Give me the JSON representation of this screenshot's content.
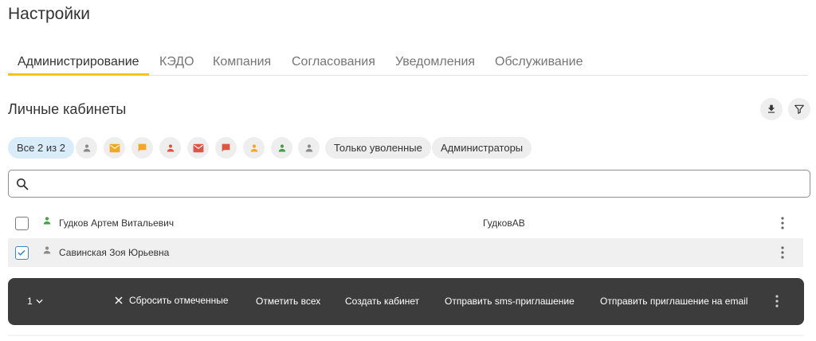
{
  "page": {
    "title": "Настройки"
  },
  "tabs": [
    "Администрирование",
    "КЭДО",
    "Компания",
    "Согласования",
    "Уведомления",
    "Обслуживание"
  ],
  "section": {
    "title": "Личные кабинеты"
  },
  "filters": {
    "all_label": "Все 2 из 2",
    "fired_label": "Только уволенные",
    "admins_label": "Администраторы",
    "icon_chips": [
      {
        "icon": "person-icon",
        "color": "#8a8a8a"
      },
      {
        "icon": "email-icon",
        "color": "#f5a623"
      },
      {
        "icon": "message-icon",
        "color": "#f5a623"
      },
      {
        "icon": "person-icon",
        "color": "#e05542"
      },
      {
        "icon": "email-icon",
        "color": "#e05542"
      },
      {
        "icon": "message-icon",
        "color": "#e05542"
      },
      {
        "icon": "person-icon",
        "color": "#f5a623"
      },
      {
        "icon": "person-icon",
        "color": "#43a047"
      },
      {
        "icon": "person-icon",
        "color": "#8a8a8a"
      }
    ]
  },
  "search": {
    "placeholder": "",
    "value": ""
  },
  "rows": [
    {
      "name": "Гудков Артем Витальевич",
      "login": "ГудковАВ",
      "checked": false,
      "status_color": "#43a047"
    },
    {
      "name": "Савинская Зоя Юрьевна",
      "login": "",
      "checked": true,
      "status_color": "#8a8a8a"
    }
  ],
  "action_bar": {
    "count": "1",
    "reset": "Сбросить отмеченные",
    "select_all": "Отметить всех",
    "create": "Создать кабинет",
    "send_sms": "Отправить sms-приглашение",
    "send_email": "Отправить приглашение на email"
  },
  "colors": {
    "accent": "#f6c50c",
    "selected_chip": "#d9ecfa",
    "checkbox_blue": "#3b87cf",
    "bar": "#3c3c3c"
  }
}
